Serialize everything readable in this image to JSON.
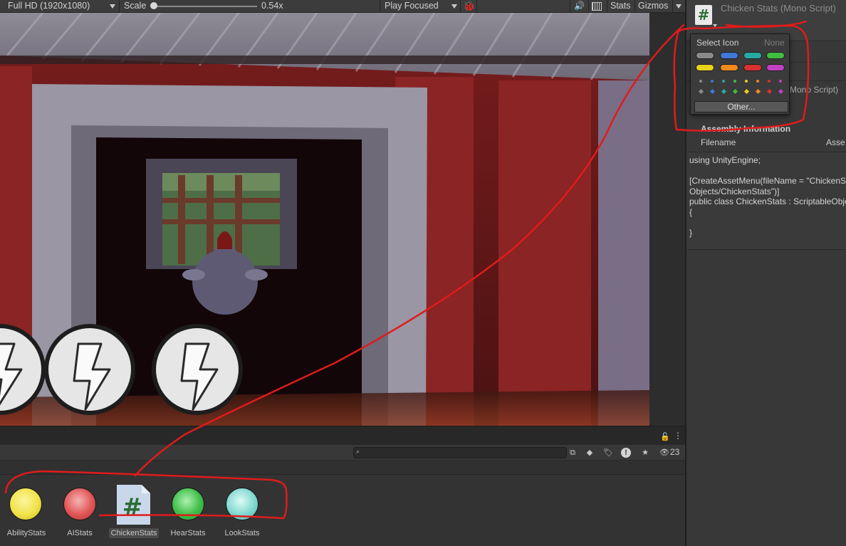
{
  "game_toolbar": {
    "resolution": "Full HD (1920x1080)",
    "scale_label": "Scale",
    "scale_value": "0.54x",
    "play_mode": "Play Focused",
    "stats_label": "Stats",
    "gizmos_label": "Gizmos"
  },
  "project": {
    "visibility_count": "23",
    "assets": [
      {
        "name": "AbilityStats",
        "color": "#f2e24a",
        "type": "icon"
      },
      {
        "name": "AIStats",
        "color": "#e05555",
        "type": "icon"
      },
      {
        "name": "ChickenStats",
        "color": "#2c6e35",
        "type": "script",
        "selected": true
      },
      {
        "name": "HearStats",
        "color": "#3fbe49",
        "type": "icon"
      },
      {
        "name": "LookStats",
        "color": "#7fd9cf",
        "type": "icon"
      }
    ]
  },
  "inspector": {
    "title": "Chicken Stats (Mono Script)",
    "partial_script_text": "Mono Script)",
    "assembly_title": "Assembly Information",
    "filename_label": "Filename",
    "asset_label_partial": "Asse",
    "code_lines": [
      "using UnityEngine;",
      "",
      "[CreateAssetMenu(fileName = \"ChickenStats\", menuName = \"Scriptable",
      "Objects/ChickenStats\")]",
      "public class ChickenStats : ScriptableObject",
      "{",
      "",
      "}"
    ]
  },
  "icon_popup": {
    "title": "Select Icon",
    "none_label": "None",
    "other_button": "Other...",
    "colors": [
      "#8a8a8a",
      "#3f78d6",
      "#27a9a0",
      "#3fbe3f",
      "#e8d21a",
      "#f08a1e",
      "#d8312f",
      "#c240c2"
    ]
  }
}
